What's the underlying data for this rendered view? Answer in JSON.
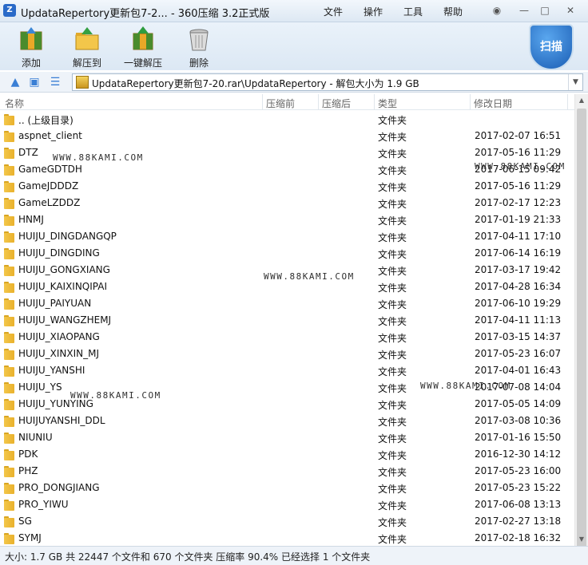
{
  "window": {
    "title": "UpdataRepertory更新包7-2... - 360压缩 3.2正式版",
    "menus": [
      "文件",
      "操作",
      "工具",
      "帮助"
    ]
  },
  "toolbar": {
    "buttons": [
      {
        "label": "添加",
        "icon": "add-archive-icon"
      },
      {
        "label": "解压到",
        "icon": "extract-to-icon"
      },
      {
        "label": "一键解压",
        "icon": "one-click-extract-icon"
      },
      {
        "label": "删除",
        "icon": "delete-trash-icon"
      }
    ],
    "scan_label": "扫描"
  },
  "address": {
    "path": "UpdataRepertory更新包7-20.rar\\UpdataRepertory - 解包大小为 1.9 GB"
  },
  "columns": {
    "name": "名称",
    "packed": "压缩前",
    "unpacked": "压缩后",
    "type": "类型",
    "modified": "修改日期"
  },
  "files": [
    {
      "name": ".. (上级目录)",
      "type": "文件夹",
      "date": ""
    },
    {
      "name": "aspnet_client",
      "type": "文件夹",
      "date": "2017-02-07 16:51"
    },
    {
      "name": "DTZ",
      "type": "文件夹",
      "date": "2017-05-16 11:29"
    },
    {
      "name": "GameGDTDH",
      "type": "文件夹",
      "date": "2017-06-15 09:42"
    },
    {
      "name": "GameJDDDZ",
      "type": "文件夹",
      "date": "2017-05-16 11:29"
    },
    {
      "name": "GameLZDDZ",
      "type": "文件夹",
      "date": "2017-02-17 12:23"
    },
    {
      "name": "HNMJ",
      "type": "文件夹",
      "date": "2017-01-19 21:33"
    },
    {
      "name": "HUIJU_DINGDANGQP",
      "type": "文件夹",
      "date": "2017-04-11 17:10"
    },
    {
      "name": "HUIJU_DINGDING",
      "type": "文件夹",
      "date": "2017-06-14 16:19"
    },
    {
      "name": "HUIJU_GONGXIANG",
      "type": "文件夹",
      "date": "2017-03-17 19:42"
    },
    {
      "name": "HUIJU_KAIXINQIPAI",
      "type": "文件夹",
      "date": "2017-04-28 16:34"
    },
    {
      "name": "HUIJU_PAIYUAN",
      "type": "文件夹",
      "date": "2017-06-10 19:29"
    },
    {
      "name": "HUIJU_WANGZHEMJ",
      "type": "文件夹",
      "date": "2017-04-11 11:13"
    },
    {
      "name": "HUIJU_XIAOPANG",
      "type": "文件夹",
      "date": "2017-03-15 14:37"
    },
    {
      "name": "HUIJU_XINXIN_MJ",
      "type": "文件夹",
      "date": "2017-05-23 16:07"
    },
    {
      "name": "HUIJU_YANSHI",
      "type": "文件夹",
      "date": "2017-04-01 16:43"
    },
    {
      "name": "HUIJU_YS",
      "type": "文件夹",
      "date": "2017-07-08 14:04"
    },
    {
      "name": "HUIJU_YUNYING",
      "type": "文件夹",
      "date": "2017-05-05 14:09"
    },
    {
      "name": "HUIJUYANSHI_DDL",
      "type": "文件夹",
      "date": "2017-03-08 10:36"
    },
    {
      "name": "NIUNIU",
      "type": "文件夹",
      "date": "2017-01-16 15:50"
    },
    {
      "name": "PDK",
      "type": "文件夹",
      "date": "2016-12-30 14:12"
    },
    {
      "name": "PHZ",
      "type": "文件夹",
      "date": "2017-05-23 16:00"
    },
    {
      "name": "PRO_DONGJIANG",
      "type": "文件夹",
      "date": "2017-05-23 15:22"
    },
    {
      "name": "PRO_YIWU",
      "type": "文件夹",
      "date": "2017-06-08 13:13"
    },
    {
      "name": "SG",
      "type": "文件夹",
      "date": "2017-02-27 13:18"
    },
    {
      "name": "SYMJ",
      "type": "文件夹",
      "date": "2017-02-18 16:32"
    }
  ],
  "watermark": "WWW.88KAMI.COM",
  "status": "大小: 1.7 GB 共 22447 个文件和 670 个文件夹 压缩率 90.4% 已经选择 1 个文件夹"
}
